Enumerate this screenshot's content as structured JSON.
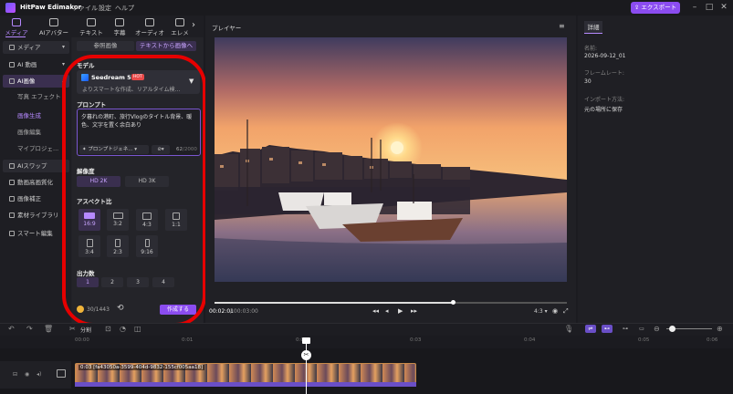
{
  "app": {
    "name": "HitPaw Edimakor",
    "menus": [
      "ファイル",
      "設定",
      "ヘルプ"
    ],
    "export_label": "エクスポート"
  },
  "toptabs": [
    {
      "label": "メディア"
    },
    {
      "label": "AIアバター"
    },
    {
      "label": "テキスト"
    },
    {
      "label": "字幕"
    },
    {
      "label": "オーディオ"
    },
    {
      "label": "エレメ"
    }
  ],
  "sidebar": {
    "media": "メディア",
    "ai_video": "AI 動画",
    "ai_image": "AI画像",
    "sub": [
      "写真 エフェクト",
      "画像生成",
      "画像編集",
      "マイプロジェ..."
    ],
    "items": [
      "AIスワップ",
      "動画高画質化",
      "画像補正",
      "素材ライブラリ",
      "スマート編集"
    ]
  },
  "panel": {
    "seg1": "参照画像",
    "seg2": "テキストから画像へ",
    "model_heading": "モデル",
    "model_name": "Seedream 5.0",
    "model_badge": "HOT",
    "model_desc": "よりスマートな作成、リアルタイム検...",
    "prompt_heading": "プロンプト",
    "prompt_text": "夕暮れの港町、旅行Vlogのタイトル背景、暖色、文字を置く余白あり",
    "prompt_gen": "プロンプトジェネ...",
    "prompt_count": "62",
    "prompt_max": "/2000",
    "resolution_heading": "解像度",
    "res1": "HD 2K",
    "res2": "HD 3K",
    "aspect_heading": "アスペクト比",
    "aspects": [
      "16:9",
      "3:2",
      "4:3",
      "1:1",
      "3:4",
      "2:3",
      "9:16"
    ],
    "count_heading": "出力数",
    "counts": [
      "1",
      "2",
      "3",
      "4"
    ],
    "credits": "30",
    "credits_total": "/1443",
    "create_label": "作成する"
  },
  "player": {
    "title": "プレイヤー",
    "time_current": "00:02:01",
    "time_total": "/ 00:03:00",
    "ratio": "4:3",
    "progress": 0.68
  },
  "details": {
    "tab": "詳細",
    "name_label": "名前:",
    "name_value": "2026-09-12_01",
    "fps_label": "フレームレート:",
    "fps_value": "30",
    "import_label": "インポート方法:",
    "import_value": "元の場所に保存"
  },
  "timeline": {
    "split_label": "分割",
    "ticks": [
      "00:00",
      "0:01",
      "0:02",
      "0:03",
      "0:04",
      "0:05",
      "0:06"
    ],
    "clip_label": "0:03 [fa43050a-3599-404d-9832-155cf005aa18]"
  },
  "colors": {
    "accent": "#8b4cf0",
    "accent_light": "#b689ff",
    "highlight_ring": "#e60000",
    "bg": "#1b1b20"
  }
}
